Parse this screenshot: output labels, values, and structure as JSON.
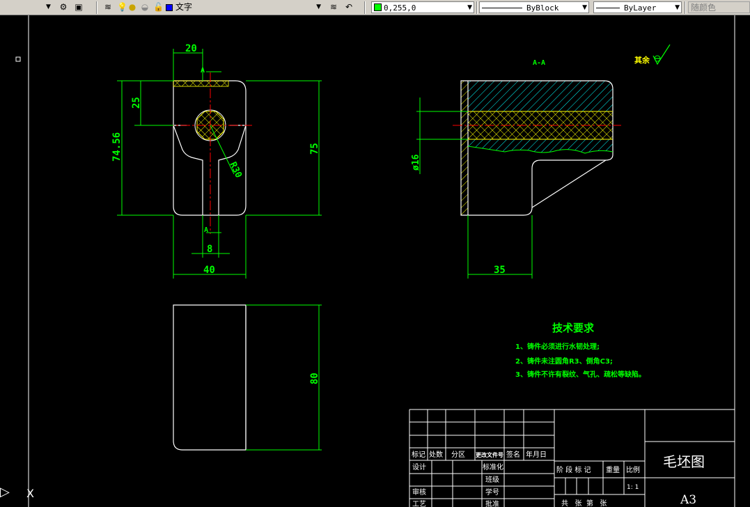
{
  "toolbar": {
    "layer_name": "文字",
    "color_value": "0,255,0",
    "color_swatch": "#00ff00",
    "linetype": "ByBlock",
    "lineweight": "ByLayer",
    "plotstyle": "随颜色"
  },
  "drawing": {
    "dims": {
      "d20": "20",
      "d25": "25",
      "d7456": "74.56",
      "d75": "75",
      "r30": "R30",
      "d8": "8",
      "d40": "40",
      "d80": "80",
      "d16": "ø16",
      "d35": "35"
    },
    "section_a_top": "A",
    "section_a_bottom": "A",
    "section_title": "A-A",
    "roughness_label": "其余",
    "tech": {
      "title": "技术要求",
      "lines": [
        "1、铸件必须进行水韧处理;",
        "2、铸件未注圆角R3、倒角C3;",
        "3、铸件不许有裂纹、气孔、疏松等缺陷。"
      ]
    },
    "title_block": {
      "cells": {
        "biaoji": "标记",
        "chushu": "处数",
        "fenqu": "分区",
        "genggai": "更改文件号",
        "qianming": "签名",
        "nianyueri": "年月日",
        "sheji": "设计",
        "biaozhunhua": "标准化",
        "banji": "班级",
        "shenhe": "审核",
        "xuehao": "学号",
        "gongyi": "工艺",
        "pizhun": "批准",
        "jieduan": "阶 段 标 记",
        "zhongliang": "重量",
        "bili": "比例",
        "bili_val": "1: 1",
        "gongzhang": "共   张  第   张"
      },
      "drawing_name": "毛坯图",
      "sheet_size": "A3"
    }
  }
}
